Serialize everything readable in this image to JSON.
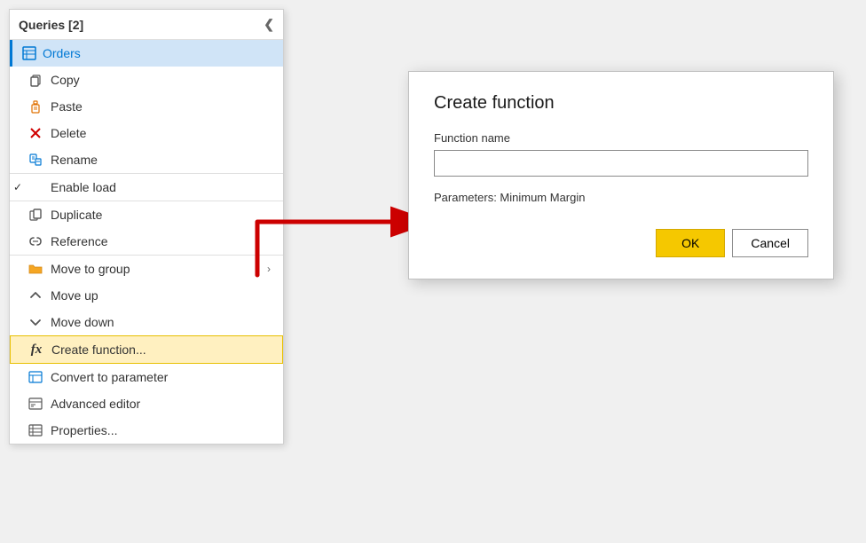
{
  "panel": {
    "title": "Queries [2]",
    "collapse_icon": "❮",
    "orders_label": "Orders",
    "menu_items": [
      {
        "id": "copy",
        "label": "Copy",
        "icon": "copy"
      },
      {
        "id": "paste",
        "label": "Paste",
        "icon": "paste"
      },
      {
        "id": "delete",
        "label": "Delete",
        "icon": "delete"
      },
      {
        "id": "rename",
        "label": "Rename",
        "icon": "rename"
      },
      {
        "id": "enable-load",
        "label": "Enable load",
        "icon": "check",
        "checked": true
      },
      {
        "id": "duplicate",
        "label": "Duplicate",
        "icon": "duplicate"
      },
      {
        "id": "reference",
        "label": "Reference",
        "icon": "reference"
      },
      {
        "id": "move-to-group",
        "label": "Move to group",
        "icon": "folder",
        "has_submenu": true
      },
      {
        "id": "move-up",
        "label": "Move up",
        "icon": "move-up"
      },
      {
        "id": "move-down",
        "label": "Move down",
        "icon": "move-down"
      },
      {
        "id": "create-function",
        "label": "Create function...",
        "icon": "fx",
        "highlighted": true
      },
      {
        "id": "convert-to-parameter",
        "label": "Convert to parameter",
        "icon": "parameter"
      },
      {
        "id": "advanced-editor",
        "label": "Advanced editor",
        "icon": "editor"
      },
      {
        "id": "properties",
        "label": "Properties...",
        "icon": "properties"
      }
    ]
  },
  "dialog": {
    "title": "Create function",
    "field_label": "Function name",
    "field_placeholder": "",
    "params_text": "Parameters: Minimum Margin",
    "btn_ok": "OK",
    "btn_cancel": "Cancel"
  }
}
